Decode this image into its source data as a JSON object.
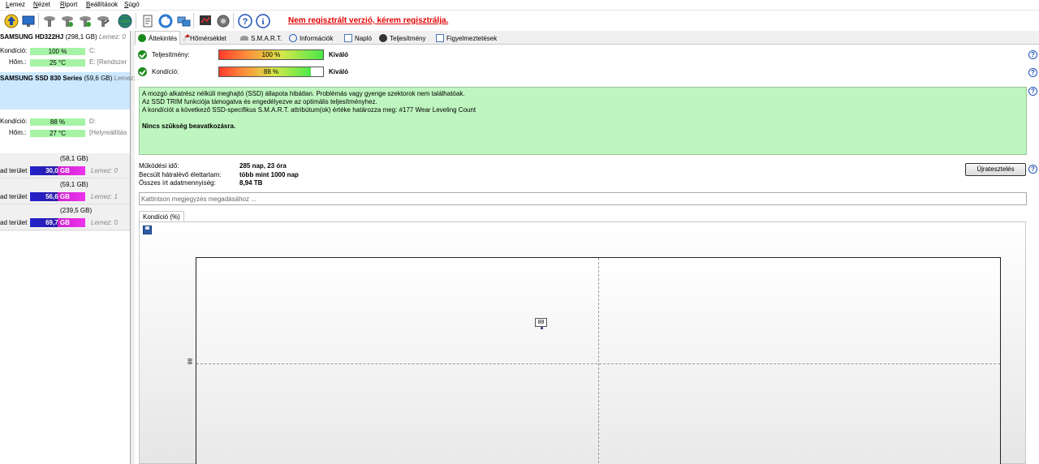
{
  "menu": [
    "Lemez",
    "Nézet",
    "Riport",
    "Beállítások",
    "Súgó"
  ],
  "registration_notice": "Nem regisztrált verzió, kérem regisztrálja.",
  "disks": [
    {
      "name": "SAMSUNG HD322HJ",
      "size": "(298,1 GB)",
      "disk_label": "Lemez: 0",
      "condition_label": "Kondíció:",
      "condition_value": "100 %",
      "condition_level": 1.0,
      "temp_label": "Hőm.:",
      "temp_value": "25 °C",
      "drive_line1": "C:",
      "drive_line2": "E:  [Rendszer",
      "selected": false
    },
    {
      "name": "SAMSUNG SSD 830 Series",
      "size": "(59,6 GB)",
      "disk_label": "Lemez:",
      "condition_label": "Kondíció:",
      "condition_value": "88 %",
      "condition_level": 0.88,
      "temp_label": "Hőm.:",
      "temp_value": "27 °C",
      "drive_line1": "D:",
      "drive_line2": "[Helyreállítás",
      "selected": true
    }
  ],
  "partitions": [
    {
      "size": "(58,1 GB)",
      "label": "",
      "free": "",
      "disk": ""
    },
    {
      "size": "(59,1 GB)",
      "label": "ad terület",
      "free": "56,6 GB",
      "disk": "Lemez: 1"
    },
    {
      "size": "(239,5 GB)",
      "label": "ad terület",
      "free": "69,7 GB",
      "disk": "Lemez: 0"
    }
  ],
  "partition_first": {
    "label": "ad terület",
    "free": "30,0 GB",
    "disk": "Lemez: 0"
  },
  "tabs": [
    {
      "label": "Áttekintés",
      "icon": "check-icon"
    },
    {
      "label": "Hőmérséklet",
      "icon": "thermometer-icon"
    },
    {
      "label": "S.M.A.R.T.",
      "icon": "smart-icon"
    },
    {
      "label": "Információk",
      "icon": "info-icon"
    },
    {
      "label": "Napló",
      "icon": "log-icon"
    },
    {
      "label": "Teljesítmény",
      "icon": "gauge-icon"
    },
    {
      "label": "Figyelmeztetések",
      "icon": "warning-icon"
    }
  ],
  "overview": {
    "performance_label": "Teljesítmény:",
    "performance_value": "100 %",
    "performance_level": 1.0,
    "performance_rating": "Kiváló",
    "condition_label": "Kondíció:",
    "condition_value": "88 %",
    "condition_level": 0.88,
    "condition_rating": "Kiváló",
    "info_lines": [
      "A mozgó alkatrész nélküli meghajtó (SSD) állapota hibátlan. Problémás vagy gyenge szektorok nem találhatóak.",
      "Az SSD TRIM funkciója támogatva és engedélyezve az optimális teljesítményhez.",
      "A kondíciót a következő SSD-specifikus S.M.A.R.T. attribútum(ok) értéke határozza meg:  #177 Wear Leveling Count"
    ],
    "info_conclusion": "Nincs szükség beavatkozásra.",
    "uptime_label": "Működési idő:",
    "uptime_value": "285 nap, 23 óra",
    "lifetime_label": "Becsült hátralévő élettartam:",
    "lifetime_value": "több mint 1000 nap",
    "written_label": "Összes írt adatmennyiség:",
    "written_value": "8,94 TB",
    "retest_button": "Újratesztelés",
    "note_placeholder": "Kattintson megjegyzés megadásához ..."
  },
  "chart_tab_label": "Kondíció  (%)",
  "chart_data": {
    "type": "line",
    "series": [
      {
        "values": [
          88
        ]
      }
    ],
    "y_tick": "88",
    "point_label": "88",
    "grid": true
  }
}
